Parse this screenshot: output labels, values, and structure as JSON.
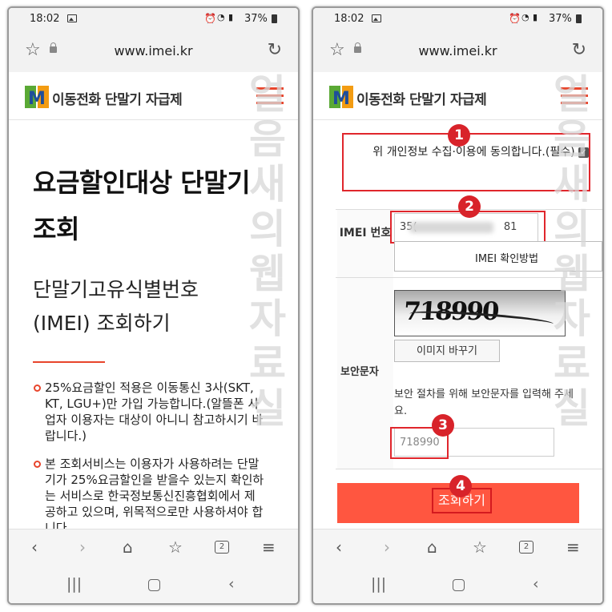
{
  "status": {
    "time": "18:02",
    "battery": "37%"
  },
  "browser": {
    "url": "www.imei.kr"
  },
  "site": {
    "logo_text": "이동전화 단말기 자급제",
    "watermark": "얼음새의웹자료실"
  },
  "left": {
    "title": "요금할인대상 단말기 조회",
    "subtitle": "단말기고유식별번호 (IMEI) 조회하기",
    "paragraphs": [
      "25%요금할인 적용은 이동통신 3사(SKT, KT, LGU+)만 가입 가능합니다.(알뜰폰 사업자 이용자는 대상이 아니니 참고하시기 바랍니다.)",
      "본 조회서비스는 이용자가 사용하려는 단말기가 25%요금할인을 받을수 있는지 확인하는 서비스로 한국정보통신진흥협회에서 제공하고 있으며, 위목적으로만 사용하셔야 합니다."
    ]
  },
  "right": {
    "agree_text": "위 개인정보 수집·이용에 동의합니다.(필수)",
    "imei_label": "IMEI 번호",
    "imei_value_start": "35(",
    "imei_value_end": "81",
    "imei_button": "IMEI 확인방법",
    "captcha_text": "718990",
    "captcha_refresh": "이미지 바꾸기",
    "security_label": "보안문자",
    "security_help": "보안 절차를 위해 보안문자를 입력해 주세요.",
    "security_value": "718990",
    "submit": "조회하기",
    "badges": [
      "1",
      "2",
      "3",
      "4"
    ]
  }
}
